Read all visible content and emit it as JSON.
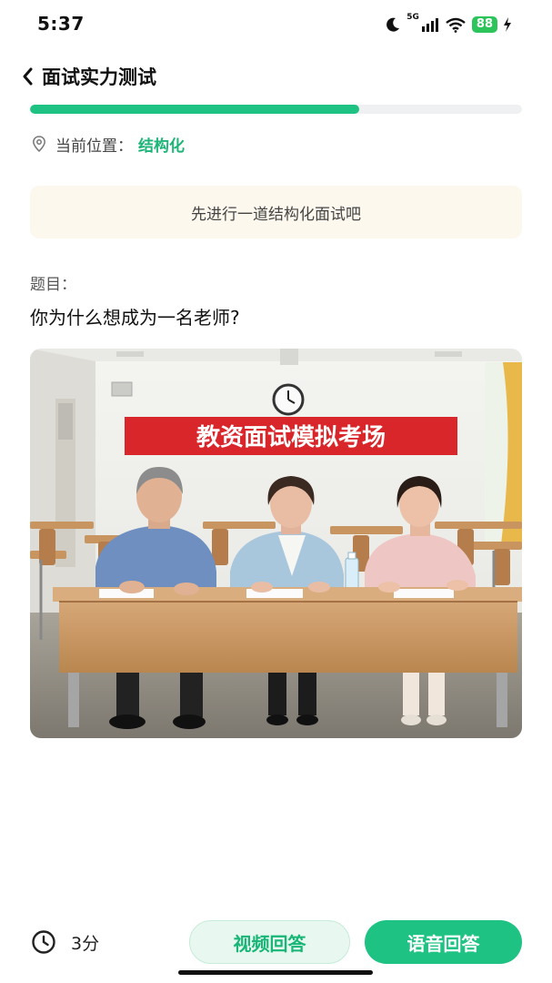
{
  "status_bar": {
    "time": "5:37",
    "network": "5G",
    "battery": "88"
  },
  "header": {
    "title": "面试实力测试"
  },
  "progress": {
    "fraction": 0.67
  },
  "location": {
    "label": "当前位置：",
    "value": "结构化"
  },
  "notice": {
    "text": "先进行一道结构化面试吧"
  },
  "question": {
    "label": "题目：",
    "text": "你为什么想成为一名老师?"
  },
  "image": {
    "banner_text": "教资面试模拟考场"
  },
  "footer": {
    "timer": "3分",
    "video_button": "视频回答",
    "voice_button": "语音回答"
  },
  "colors": {
    "accent": "#1ec282",
    "notice_bg": "#fdf8ee",
    "banner_red": "#d8262a"
  }
}
